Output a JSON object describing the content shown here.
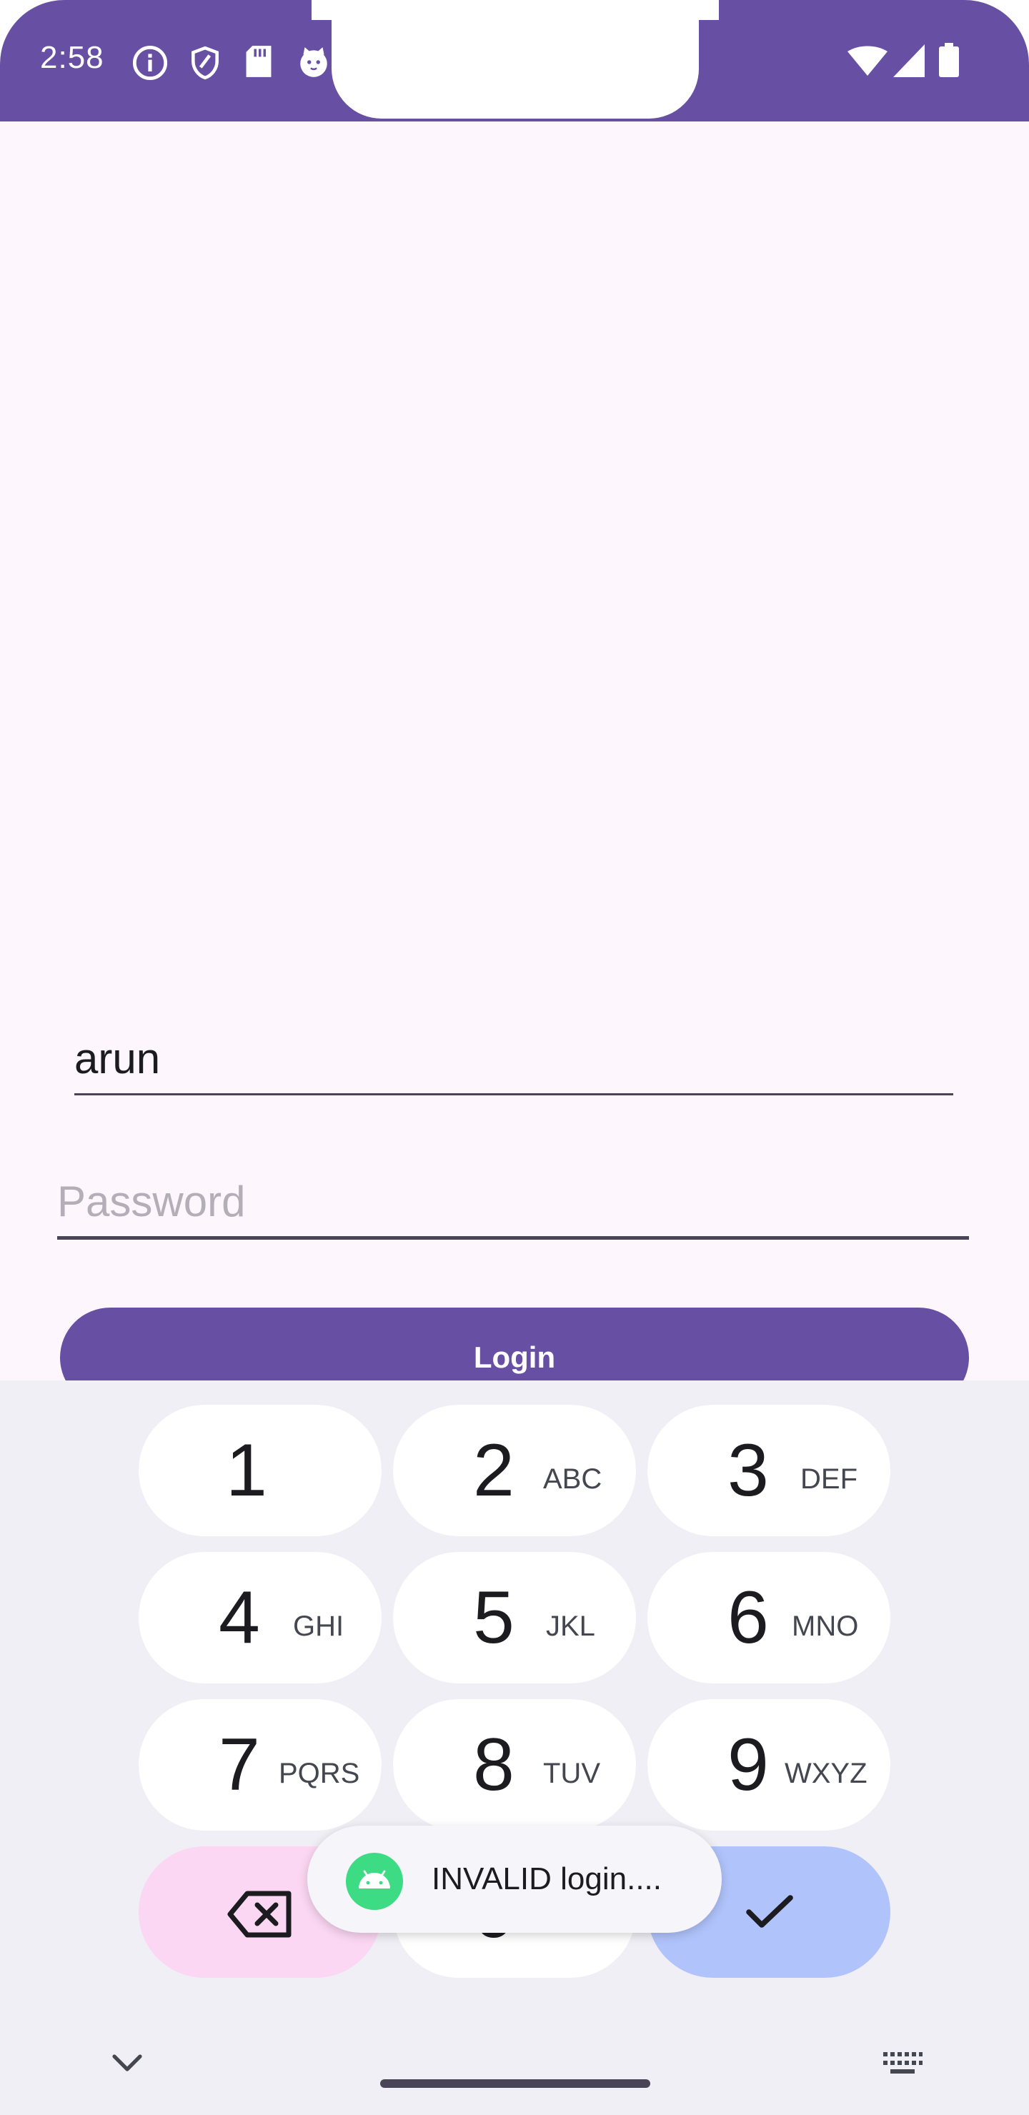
{
  "status_bar": {
    "time": "2:58",
    "left_icons": [
      "info-icon",
      "shield-icon",
      "sd-card-icon",
      "cat-face-icon"
    ],
    "right_icons": [
      "wifi-icon",
      "cellular-signal-icon",
      "battery-icon"
    ]
  },
  "login_form": {
    "username_value": "arun",
    "password_placeholder": "Password",
    "password_value": "",
    "login_label": "Login"
  },
  "keyboard": {
    "keys": [
      {
        "digit": "1",
        "letters": ""
      },
      {
        "digit": "2",
        "letters": "ABC"
      },
      {
        "digit": "3",
        "letters": "DEF"
      },
      {
        "digit": "4",
        "letters": "GHI"
      },
      {
        "digit": "5",
        "letters": "JKL"
      },
      {
        "digit": "6",
        "letters": "MNO"
      },
      {
        "digit": "7",
        "letters": "PQRS"
      },
      {
        "digit": "8",
        "letters": "TUV"
      },
      {
        "digit": "9",
        "letters": "WXYZ"
      },
      {
        "digit": "0",
        "letters": ""
      }
    ],
    "backspace_icon": "backspace-icon",
    "done_icon": "checkmark-icon",
    "collapse_icon": "chevron-down-icon",
    "switch_keyboard_icon": "keyboard-icon"
  },
  "toast": {
    "message": "INVALID login....",
    "icon": "android-app-icon"
  },
  "colors": {
    "primary": "#6750a4",
    "app_background": "#fdf7fd",
    "keyboard_background": "#efeff5",
    "backspace_key": "#fbd7f3",
    "done_key": "#b0c3fb"
  }
}
